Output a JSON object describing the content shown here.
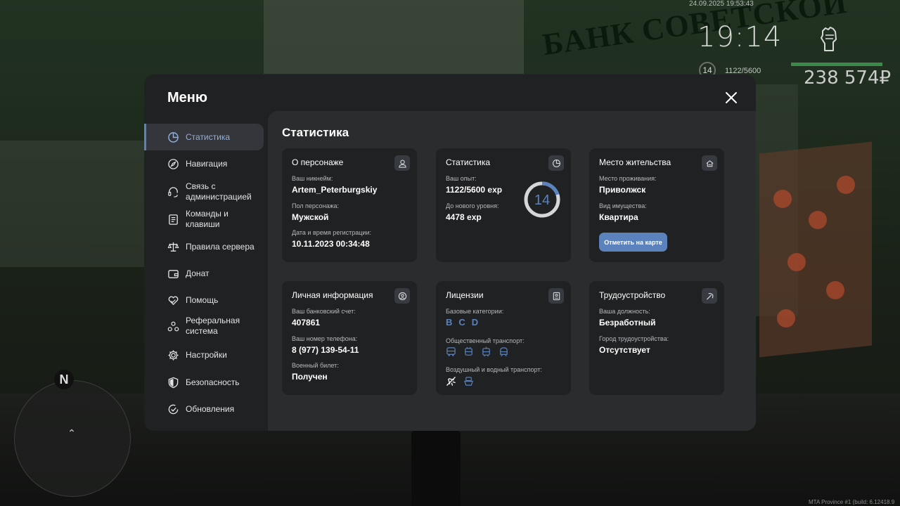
{
  "hud": {
    "datetime": "24.09.2025 19:53:43",
    "clock": "19:14",
    "level": "14",
    "exp": "1122/5600",
    "money": "238 574₽",
    "compass": "N",
    "build": "MTA Province #1 (build: 6.12418.9"
  },
  "scene": {
    "sign": "БАНК СОВЕТСКОЙ"
  },
  "menu": {
    "title": "Меню",
    "sidebar": [
      {
        "label": "Статистика",
        "icon": "pie-chart-icon",
        "active": true
      },
      {
        "label": "Навигация",
        "icon": "compass-icon"
      },
      {
        "label": "Связь с администрацией",
        "icon": "headset-icon"
      },
      {
        "label": "Команды и клавиши",
        "icon": "document-icon"
      },
      {
        "label": "Правила сервера",
        "icon": "scales-icon"
      },
      {
        "label": "Донат",
        "icon": "wallet-icon"
      },
      {
        "label": "Помощь",
        "icon": "heart-hand-icon"
      },
      {
        "label": "Реферальная система",
        "icon": "network-icon"
      },
      {
        "label": "Настройки",
        "icon": "gear-icon"
      },
      {
        "label": "Безопасность",
        "icon": "shield-icon"
      },
      {
        "label": "Обновления",
        "icon": "check-circle-icon"
      }
    ],
    "content_title": "Статистика",
    "cards": {
      "character": {
        "title": "О персонаже",
        "nickname_label": "Ваш никнейм:",
        "nickname": "Artem_Peterburgskiy",
        "gender_label": "Пол персонажа:",
        "gender": "Мужской",
        "reg_label": "Дата и время регистрации:",
        "reg": "10.11.2023 00:34:48"
      },
      "stats": {
        "title": "Статистика",
        "exp_label": "Ваш опыт:",
        "exp": "1122/5600 exp",
        "next_label": "До нового уровня:",
        "next": "4478 exp",
        "level": "14",
        "progress": 0.2
      },
      "residence": {
        "title": "Место жительства",
        "place_label": "Место проживания:",
        "place": "Приволжск",
        "property_label": "Вид имущества:",
        "property": "Квартира",
        "button": "Отметить на карте"
      },
      "personal": {
        "title": "Личная информация",
        "bank_label": "Ваш банковский счет:",
        "bank": "407861",
        "phone_label": "Ваш номер телефона:",
        "phone": "8 (977) 139-54-11",
        "military_label": "Военный билет:",
        "military": "Получен"
      },
      "licenses": {
        "title": "Лицензии",
        "base_label": "Базовые категории:",
        "base": [
          "B",
          "C",
          "D"
        ],
        "public_label": "Общественный транспорт:",
        "air_label": "Воздушный и водный транспорт:"
      },
      "employment": {
        "title": "Трудоустройство",
        "position_label": "Ваша должность:",
        "position": "Безработный",
        "city_label": "Город трудоустройства:",
        "city": "Отсутствует"
      }
    }
  },
  "colors": {
    "accent": "#5b82bd",
    "panel": "#202123",
    "content": "#2b2c2e",
    "card": "#202123"
  }
}
